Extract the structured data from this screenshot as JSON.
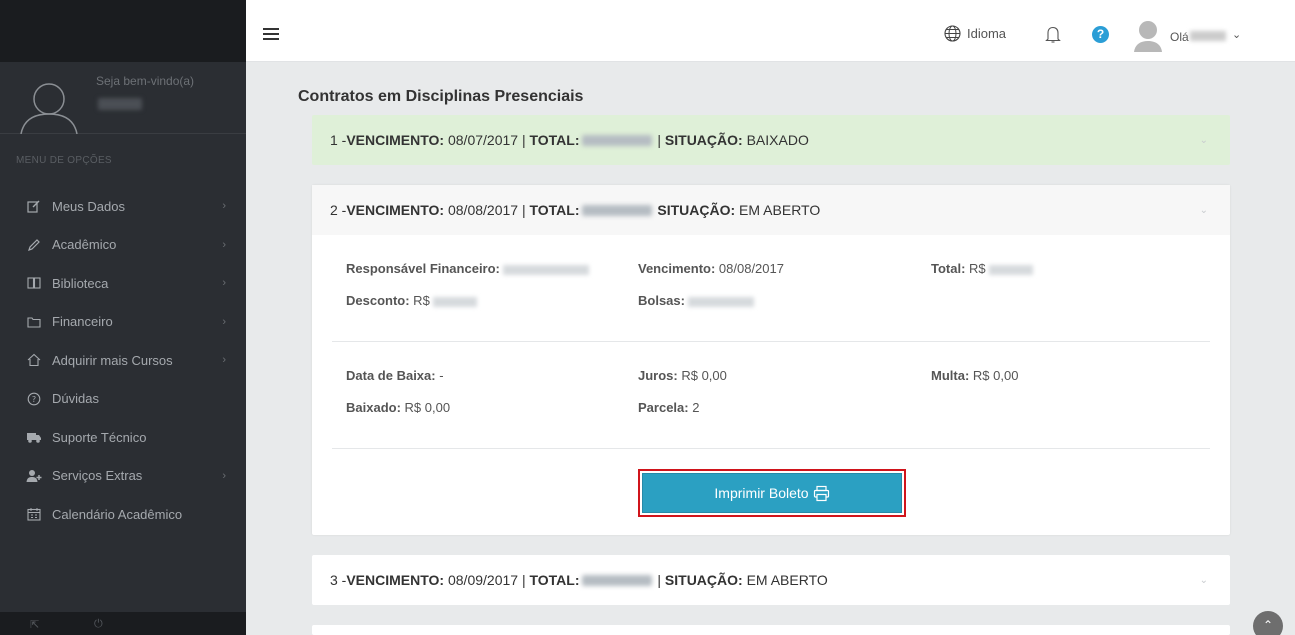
{
  "sidebar": {
    "welcome": "Seja bem-vindo(a)",
    "menu_title": "MENU DE OPÇÕES",
    "items": [
      {
        "label": "Meus Dados",
        "icon": "edit-icon",
        "chevron": true
      },
      {
        "label": "Acadêmico",
        "icon": "pencil-icon",
        "chevron": true
      },
      {
        "label": "Biblioteca",
        "icon": "book-icon",
        "chevron": true
      },
      {
        "label": "Financeiro",
        "icon": "folder-icon",
        "chevron": true
      },
      {
        "label": "Adquirir mais Cursos",
        "icon": "home-icon",
        "chevron": true
      },
      {
        "label": "Dúvidas",
        "icon": "question-circle-icon",
        "chevron": false
      },
      {
        "label": "Suporte Técnico",
        "icon": "ambulance-icon",
        "chevron": false
      },
      {
        "label": "Serviços Extras",
        "icon": "user-plus-icon",
        "chevron": true
      },
      {
        "label": "Calendário Acadêmico",
        "icon": "calendar-icon",
        "chevron": false
      }
    ]
  },
  "header": {
    "language_label": "Idioma",
    "greeting": "Olá"
  },
  "main": {
    "title": "Contratos em Disciplinas Presenciais",
    "contracts": [
      {
        "num": "1 - ",
        "venc_label": "VENCIMENTO:",
        "venc": " 08/07/2017 | ",
        "total_label": "TOTAL:",
        "sep": " | ",
        "sit_label": "SITUAÇÃO:",
        "sit": " BAIXADO"
      },
      {
        "num": "2 - ",
        "venc_label": "VENCIMENTO:",
        "venc": " 08/08/2017 | ",
        "total_label": "TOTAL:",
        "sep": " ",
        "sit_label": "SITUAÇÃO:",
        "sit": " EM ABERTO"
      },
      {
        "num": "3 - ",
        "venc_label": "VENCIMENTO:",
        "venc": " 08/09/2017 | ",
        "total_label": "TOTAL:",
        "sep": " | ",
        "sit_label": "SITUAÇÃO:",
        "sit": " EM ABERTO"
      }
    ],
    "details": {
      "responsavel_label": "Responsável Financeiro:",
      "vencimento_label": "Vencimento:",
      "vencimento_value": " 08/08/2017",
      "total_label": "Total:",
      "total_prefix": " R$",
      "desconto_label": "Desconto:",
      "desconto_prefix": " R$",
      "bolsas_label": "Bolsas:",
      "data_baixa_label": "Data de Baixa:",
      "data_baixa_value": " -",
      "juros_label": "Juros:",
      "juros_value": " R$ 0,00",
      "multa_label": "Multa:",
      "multa_value": " R$ 0,00",
      "baixado_label": "Baixado:",
      "baixado_value": " R$ 0,00",
      "parcela_label": "Parcela:",
      "parcela_value": " 2"
    },
    "print_button": "Imprimir Boleto"
  },
  "colors": {
    "accent": "#2ba0c2",
    "highlight_border": "#d0141b",
    "paid_row": "#dff0d8",
    "sidebar": "#2b2e33"
  }
}
